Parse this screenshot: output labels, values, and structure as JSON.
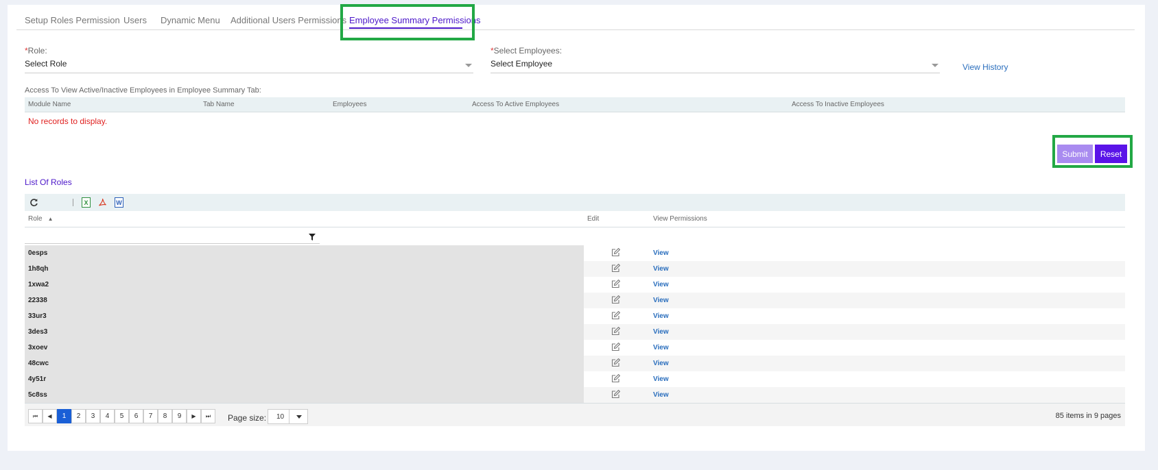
{
  "tabs": [
    {
      "label": "Setup Roles Permission"
    },
    {
      "label": "Users"
    },
    {
      "label": "Dynamic Menu"
    },
    {
      "label": "Additional Users Permissions"
    },
    {
      "label": "Employee Summary Permissions"
    }
  ],
  "form": {
    "role_required": "*",
    "role_label": "Role:",
    "role_value": "Select Role",
    "emp_required": "*",
    "emp_label": "Select Employees:",
    "emp_value": "Select Employee",
    "view_history": "View History"
  },
  "access": {
    "title": "Access To View Active/Inactive Employees in Employee Summary Tab:",
    "columns": [
      "Module Name",
      "Tab Name",
      "Employees",
      "Access To Active Employees",
      "Access To Inactive Employees"
    ],
    "empty_text": "No records to display."
  },
  "buttons": {
    "submit": "Submit",
    "reset": "Reset"
  },
  "roles_list": {
    "title": "List Of Roles",
    "columns": {
      "role": "Role",
      "sort_indicator": "▲",
      "edit": "Edit",
      "view_permissions": "View Permissions"
    },
    "rows": [
      {
        "role": "0esps",
        "view": "View"
      },
      {
        "role": "1h8qh",
        "view": "View"
      },
      {
        "role": "1xwa2",
        "view": "View"
      },
      {
        "role": "22338",
        "view": "View"
      },
      {
        "role": "33ur3",
        "view": "View"
      },
      {
        "role": "3des3",
        "view": "View"
      },
      {
        "role": "3xoev",
        "view": "View"
      },
      {
        "role": "48cwc",
        "view": "View"
      },
      {
        "role": "4y51r",
        "view": "View"
      },
      {
        "role": "5c8ss",
        "view": "View"
      }
    ],
    "toolbar_icons": [
      "refresh-icon",
      "excel-export-icon",
      "pdf-export-icon",
      "word-export-icon"
    ]
  },
  "pager": {
    "pages": [
      "1",
      "2",
      "3",
      "4",
      "5",
      "6",
      "7",
      "8",
      "9"
    ],
    "current_page": "1",
    "page_size_label": "Page size:",
    "page_size": "10",
    "info": "85 items in 9 pages"
  },
  "colors": {
    "accent": "#4b16c9",
    "highlight_box": "#22a845",
    "submit": "#a98bf0",
    "reset": "#5a14e8",
    "link": "#2a6ebd",
    "error": "#e0201f"
  }
}
